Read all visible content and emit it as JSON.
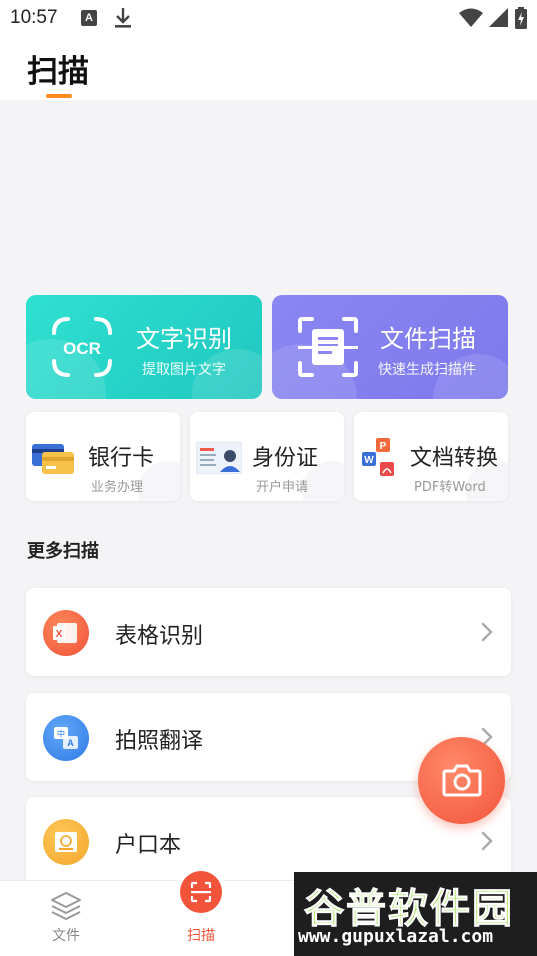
{
  "status_bar": {
    "time": "10:57",
    "notification_a": "A"
  },
  "header": {
    "title": "扫描"
  },
  "big_cards": [
    {
      "id": "ocr",
      "icon_text": "OCR",
      "title": "文字识别",
      "subtitle": "提取图片文字",
      "color": "#22d3c8"
    },
    {
      "id": "scan",
      "title": "文件扫描",
      "subtitle": "快速生成扫描件",
      "color": "#8481f0"
    }
  ],
  "small_cards": [
    {
      "id": "bank",
      "title": "银行卡",
      "subtitle": "业务办理"
    },
    {
      "id": "idcard",
      "title": "身份证",
      "subtitle": "开户申请"
    },
    {
      "id": "convert",
      "title": "文档转换",
      "subtitle": "PDF转Word"
    }
  ],
  "section": {
    "more_scan": "更多扫描"
  },
  "list": [
    {
      "label": "表格识别",
      "icon": "excel-icon",
      "color": "#f36a3c"
    },
    {
      "label": "拍照翻译",
      "icon": "translate-icon",
      "color": "#3b8ef0"
    },
    {
      "label": "户口本",
      "icon": "household-book-icon",
      "color": "#f5b33a"
    }
  ],
  "bottom_nav": {
    "files": "文件",
    "scan": "扫描"
  },
  "accent_color": "#f2543a",
  "watermark": {
    "title": "谷普软件园",
    "url": "www.gupuxlazal.com"
  }
}
